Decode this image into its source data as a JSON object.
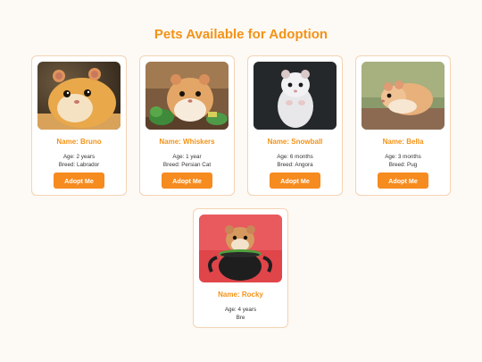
{
  "page": {
    "title": "Pets Available for Adoption",
    "button_label": "Adopt Me"
  },
  "pets": [
    {
      "name": "Name: Bruno",
      "age": "Age: 2 years",
      "breed": "Breed: Labrador"
    },
    {
      "name": "Name: Whiskers",
      "age": "Age: 1 year",
      "breed": "Breed: Persian Cat"
    },
    {
      "name": "Name: Snowball",
      "age": "Age: 6 months",
      "breed": "Breed: Angora"
    },
    {
      "name": "Name: Bella",
      "age": "Age: 3 months",
      "breed": "Breed: Pug"
    },
    {
      "name": "Name: Rocky",
      "age": "Age: 4 years",
      "breed": "Bre"
    }
  ],
  "colors": {
    "accent": "#f39317",
    "button": "#f68b1f",
    "card_border": "#f3d3b3",
    "background": "#fdf9f4"
  }
}
